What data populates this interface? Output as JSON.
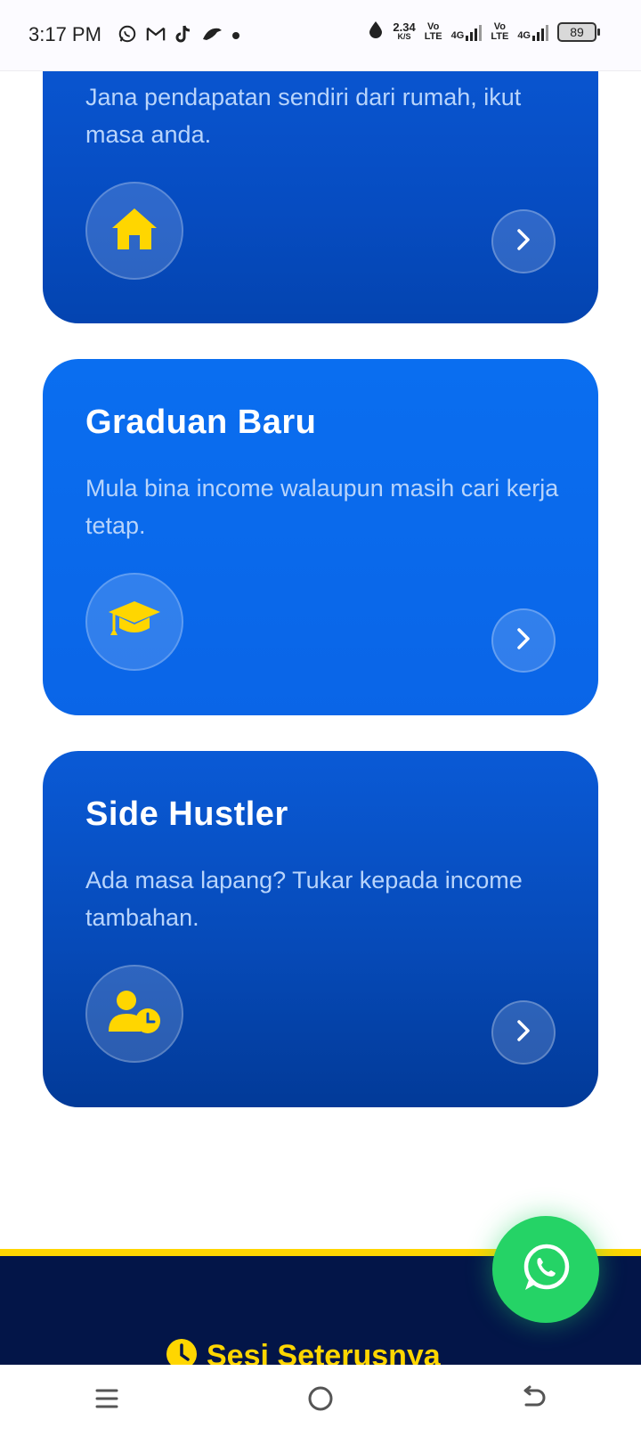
{
  "status_bar": {
    "time": "3:17 PM",
    "net_speed_value": "2.34",
    "net_speed_unit": "K/S",
    "sim1_label": "Vo",
    "sim1_sub": "LTE",
    "sim1_net": "4G",
    "sim2_label": "Vo",
    "sim2_sub": "LTE",
    "sim2_net": "4G",
    "battery": "89",
    "icons_left": [
      "whatsapp-icon",
      "gmail-icon",
      "tiktok-icon",
      "bird-icon",
      "dot-icon"
    ]
  },
  "cards": [
    {
      "title": "",
      "desc": "Jana pendapatan sendiri dari rumah, ikut masa anda.",
      "icon": "home-icon"
    },
    {
      "title": "Graduan Baru",
      "desc": "Mula bina income walaupun masih cari kerja tetap.",
      "icon": "graduation-cap-icon"
    },
    {
      "title": "Side Hustler",
      "desc": "Ada masa lapang? Tukar kepada income tambahan.",
      "icon": "user-clock-icon"
    }
  ],
  "footer": {
    "heading": "Sesi Seterusnya",
    "icon": "clock-icon"
  },
  "fab": {
    "icon": "whatsapp-icon"
  },
  "colors": {
    "accent_yellow": "#ffd600",
    "card_blue": "#0a6ef0",
    "footer_navy": "#031548",
    "whatsapp_green": "#25d366"
  },
  "nav": [
    "recent-apps-icon",
    "home-button-icon",
    "back-icon"
  ]
}
